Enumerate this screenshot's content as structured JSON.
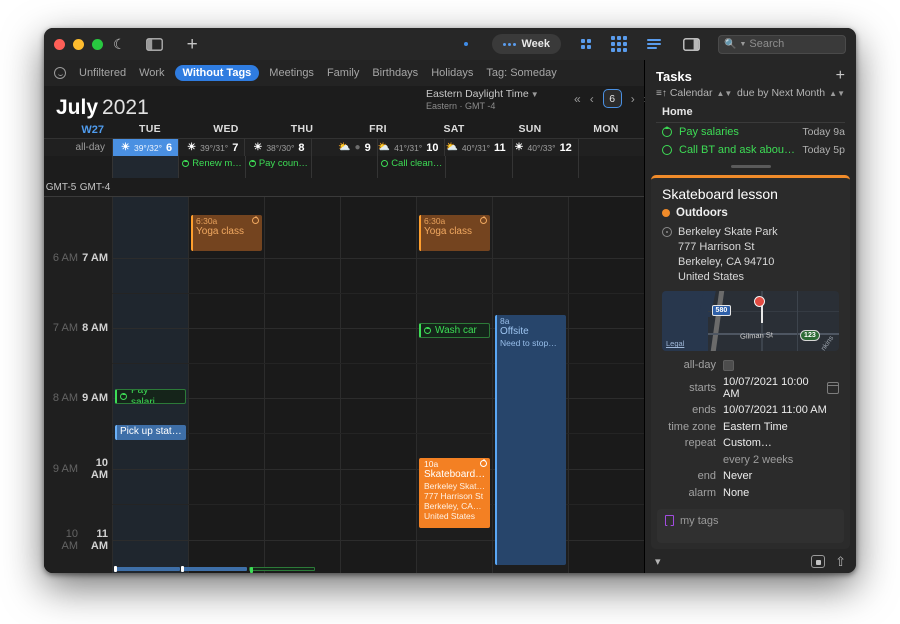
{
  "window": {
    "traffic_lights": [
      "close",
      "minimize",
      "zoom"
    ],
    "toolbar": {
      "moon_icon": "moon-icon",
      "sidebar_toggle_icon": "sidebar-toggle-icon",
      "add_icon": "plus-icon",
      "view_pill": "Week",
      "grid_small_icon": "grid-4-icon",
      "grid_large_icon": "grid-9-icon",
      "list_icon": "list-lines-icon",
      "right_panel_icon": "right-panel-toggle-icon",
      "search_placeholder": "Search"
    }
  },
  "tagbar": {
    "smiley_icon": "smiley-icon",
    "items": [
      {
        "label": "Unfiltered",
        "active": false
      },
      {
        "label": "Work",
        "active": false
      },
      {
        "label": "Without Tags",
        "active": true
      },
      {
        "label": "Meetings",
        "active": false
      },
      {
        "label": "Family",
        "active": false
      },
      {
        "label": "Birthdays",
        "active": false
      },
      {
        "label": "Holidays",
        "active": false
      },
      {
        "label": "Tag: Someday",
        "active": false
      }
    ]
  },
  "header": {
    "month": "July",
    "year": "2021",
    "timezone_line1": "Eastern Daylight Time",
    "timezone_line2": "Eastern · GMT -4",
    "nav": {
      "prev_fast": "«",
      "prev": "‹",
      "today": "6",
      "next": "›",
      "next_fast": "»"
    },
    "week_label": "W27"
  },
  "days": [
    {
      "weekday": "W27",
      "daynum": "6",
      "weather": "☀",
      "temps": "39°/32°",
      "selected": true,
      "weekend": false
    },
    {
      "weekday": "TUE",
      "daynum": "7",
      "weather": "☀",
      "temps": "39°/31°",
      "selected": false,
      "weekend": false
    },
    {
      "weekday": "WED",
      "daynum": "8",
      "weather": "☀",
      "temps": "38°/30°",
      "selected": false,
      "weekend": false
    },
    {
      "weekday": "THU",
      "daynum": "9",
      "weather": "⛅",
      "temps": "",
      "selected": false,
      "weekend": false
    },
    {
      "weekday": "FRI",
      "daynum": "10",
      "weather": "⛅",
      "temps": "41°/31°",
      "selected": false,
      "weekend": false
    },
    {
      "weekday": "SAT",
      "daynum": "11",
      "weather": "⛅",
      "temps": "40°/31°",
      "selected": false,
      "weekend": true
    },
    {
      "weekday": "SUN",
      "daynum": "12",
      "weather": "☀",
      "temps": "40°/33°",
      "selected": false,
      "weekend": true
    },
    {
      "weekday": "MON",
      "daynum": "",
      "weather": "",
      "temps": "",
      "selected": false,
      "weekend": false
    }
  ],
  "day_header_labels": [
    "W27",
    "TUE",
    "WED",
    "THU",
    "FRI",
    "SAT",
    "SUN",
    "MON"
  ],
  "allday": {
    "label": "all-day",
    "events": [
      {
        "col": 1,
        "title": "Renew m…",
        "icon": "repeat-ring-icon"
      },
      {
        "col": 2,
        "title": "Pay coun…",
        "icon": "repeat-ring-icon"
      },
      {
        "col": 4,
        "title": "Call clean…",
        "icon": "ring-icon"
      }
    ]
  },
  "gmt_labels": [
    "GMT-5",
    "GMT-4"
  ],
  "time_gutter": {
    "left_column": [
      "6 AM",
      "7 AM",
      "8 AM",
      "9 AM",
      "10 AM"
    ],
    "right_column": [
      "7 AM",
      "8 AM",
      "9 AM",
      "10 AM",
      "11 AM"
    ]
  },
  "events": [
    {
      "title": "Yoga class",
      "time": "6:30a",
      "col": 1,
      "style": "orange",
      "repeat": true
    },
    {
      "title": "Yoga class",
      "time": "6:30a",
      "col": 4,
      "style": "orange",
      "repeat": true
    },
    {
      "title": "Wash car",
      "time": "",
      "col": 4,
      "style": "green-outline",
      "repeat": true
    },
    {
      "title": "Offsite",
      "time": "8a",
      "col": 6,
      "style": "blue",
      "note": "Need to stop…"
    },
    {
      "title": "Pay salari…",
      "time": "",
      "col": 0,
      "style": "green-outline",
      "repeat": true
    },
    {
      "title": "Pick up stat…",
      "time": "",
      "col": 0,
      "style": "blue-solid"
    },
    {
      "title": "Skateboard…",
      "time": "10a",
      "col": 4,
      "style": "orange-solid",
      "repeat": true,
      "lines": [
        "Berkeley Skat…",
        "777 Harrison St",
        "Berkeley, CA…",
        "United States"
      ]
    }
  ],
  "tasks": {
    "title": "Tasks",
    "add_icon": "plus-icon",
    "sort_label": "Calendar",
    "sort_icon": "sort-icon",
    "due_label": "due by Next Month",
    "group": "Home",
    "items": [
      {
        "name": "Pay salaries",
        "due": "Today 9a",
        "icon": "repeat-ring-icon"
      },
      {
        "name": "Call BT and ask about…",
        "due": "Today 5p",
        "icon": "ring-icon"
      }
    ]
  },
  "inspector": {
    "accent_color": "#f08b2a",
    "event_title": "Skateboard lesson",
    "calendar_name": "Outdoors",
    "calendar_color": "#f08b2a",
    "location_icon": "location-pin-icon",
    "location_lines": [
      "Berkeley Skate Park",
      "777 Harrison St",
      "Berkeley, CA  94710",
      "United States"
    ],
    "map": {
      "highway_shield": "580",
      "route_shield": "123",
      "street_label": "Gilman St",
      "street_label2": "…nkins",
      "legal": "Legal",
      "pin_icon": "map-pin-icon"
    },
    "fields": [
      {
        "label": "all-day",
        "value": "",
        "control": "checkbox"
      },
      {
        "label": "starts",
        "value": "10/07/2021   10:00 AM",
        "control": "calendar-button"
      },
      {
        "label": "ends",
        "value": "10/07/2021   11:00 AM",
        "control": ""
      },
      {
        "label": "time zone",
        "value": "Eastern Time",
        "control": ""
      },
      {
        "label": "repeat",
        "value": "Custom…",
        "control": ""
      },
      {
        "label": "",
        "value": "every 2 weeks",
        "control": "",
        "muted": true
      },
      {
        "label": "end",
        "value": "Never",
        "control": ""
      },
      {
        "label": "alarm",
        "value": "None",
        "control": ""
      }
    ],
    "tags_placeholder": "my tags",
    "tags_icon": "bookmark-icon",
    "footer": {
      "collapse_icon": "chevron-down-icon",
      "attach_icon": "add-attachment-icon",
      "share_icon": "share-icon"
    }
  }
}
